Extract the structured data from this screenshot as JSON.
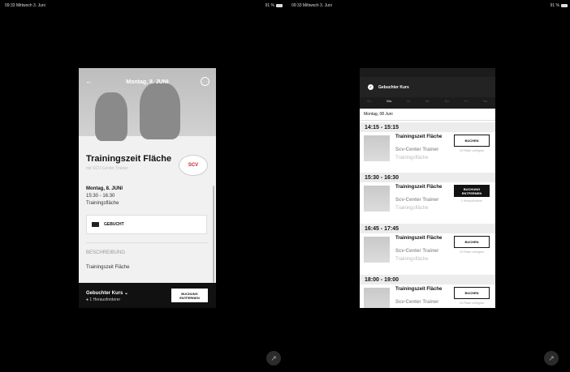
{
  "status": {
    "left_time": "09:33  Mittwoch 3. Juni",
    "left_battery": "91 %",
    "right_time": "09:33  Mittwoch 3. Juni",
    "right_battery": "91 %"
  },
  "left": {
    "header_title": "Montag, 8. JUNI",
    "class_title": "Trainingszeit Fläche",
    "trainer": "mit SCV-Center Trainer",
    "logo_text": "SCV",
    "date": "Montag, 8. JUNI",
    "time": "15:30  -  16:30",
    "area": "Trainingsfläche",
    "booked_label": "GEBUCHT",
    "description_heading": "BESCHREIBUNG",
    "description": "Trainingszeit Fläche",
    "footer_title": "Gebuchter Kurs",
    "footer_sub": "1 Herausforderer",
    "footer_button": "BUCHUNG ENTFERNEN"
  },
  "right": {
    "toast": "Gebuchter Kurs",
    "days": [
      "So.",
      "Mo.",
      "Di.",
      "Mi.",
      "Do.",
      "Fr.",
      "Sa."
    ],
    "date_line": "Montag, 08 Juni",
    "slots": [
      {
        "time": "14:15 - 15:15",
        "name": "Trainingszeit Fläche",
        "trainer": "Scv-Center Trainer",
        "area": "Trainingsfläche",
        "button": "BUCHEN",
        "avail": "15 Plätze verfügbar"
      },
      {
        "time": "15:30 - 16:30",
        "name": "Trainingszeit Fläche",
        "trainer": "Scv-Center Trainer",
        "area": "Trainingsfläche",
        "button": "BUCHUNG ENTFERNEN",
        "avail": "1 Herausforderer"
      },
      {
        "time": "16:45 - 17:45",
        "name": "Trainingszeit Fläche",
        "trainer": "Scv-Center Trainer",
        "area": "Trainingsfläche",
        "button": "BUCHEN",
        "avail": "15 Plätze verfügbar"
      },
      {
        "time": "18:00 - 19:00",
        "name": "Trainingszeit Fläche",
        "trainer": "Scv-Center Trainer",
        "area": "",
        "button": "BUCHEN",
        "avail": "15 Plätze verfügbar"
      }
    ]
  }
}
